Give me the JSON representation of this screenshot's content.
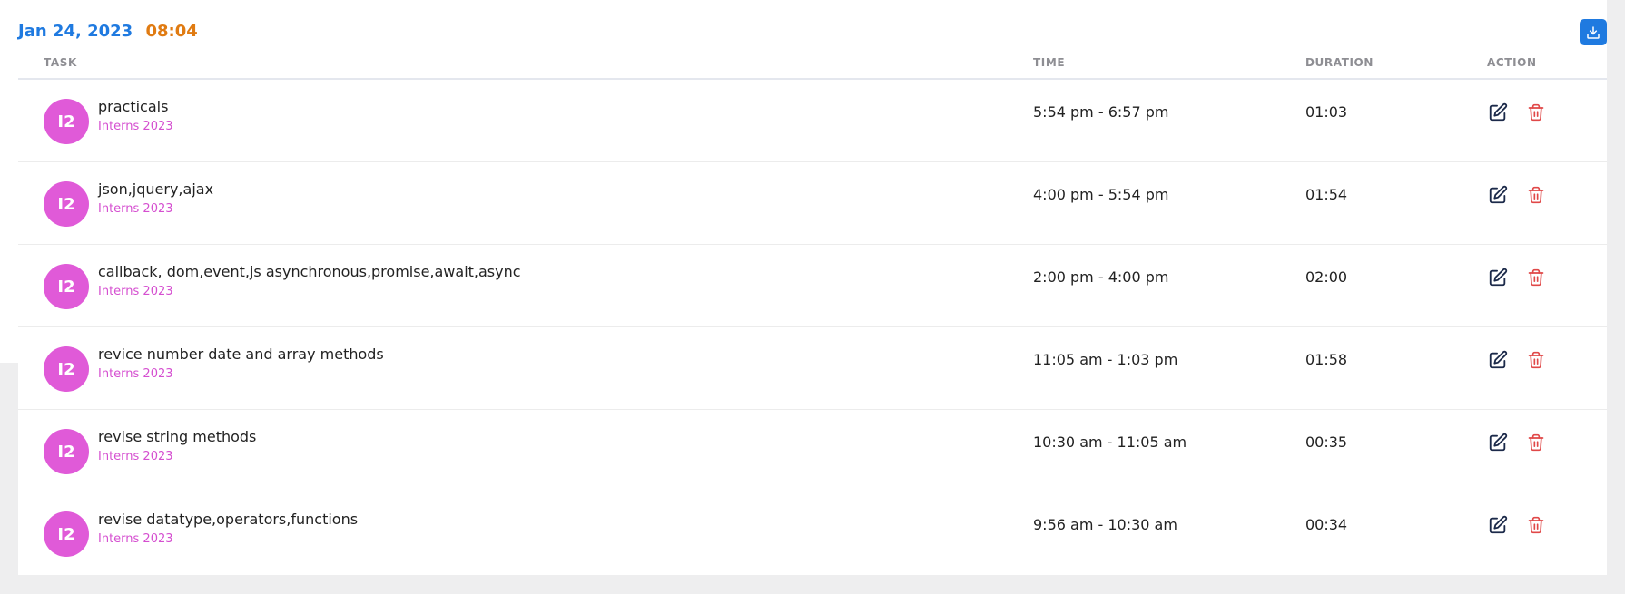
{
  "header": {
    "date": "Jan 24, 2023",
    "time": "08:04",
    "download_icon": "download-icon"
  },
  "table": {
    "columns": {
      "task": "TASK",
      "time": "TIME",
      "duration": "DURATION",
      "action": "ACTION"
    },
    "rows": [
      {
        "avatar": "I2",
        "task": "practicals",
        "project": "Interns 2023",
        "time": "5:54 pm - 6:57 pm",
        "duration": "01:03"
      },
      {
        "avatar": "I2",
        "task": "json,jquery,ajax",
        "project": "Interns 2023",
        "time": "4:00 pm - 5:54 pm",
        "duration": "01:54"
      },
      {
        "avatar": "I2",
        "task": "callback, dom,event,js asynchronous,promise,await,async",
        "project": "Interns 2023",
        "time": "2:00 pm - 4:00 pm",
        "duration": "02:00"
      },
      {
        "avatar": "I2",
        "task": "revice number date and array methods",
        "project": "Interns 2023",
        "time": "11:05 am - 1:03 pm",
        "duration": "01:58"
      },
      {
        "avatar": "I2",
        "task": "revise string methods",
        "project": "Interns 2023",
        "time": "10:30 am - 11:05 am",
        "duration": "00:35"
      },
      {
        "avatar": "I2",
        "task": "revise datatype,operators,functions",
        "project": "Interns 2023",
        "time": "9:56 am - 10:30 am",
        "duration": "00:34"
      }
    ]
  },
  "icons": {
    "edit": "edit-icon",
    "delete": "trash-icon"
  },
  "colors": {
    "date": "#1f7ae0",
    "time": "#e07b12",
    "avatar": "#e05ad8",
    "project": "#d54fd0",
    "delete": "#e04848",
    "edit": "#1c2a4a",
    "download_bg": "#1f7ae0"
  }
}
